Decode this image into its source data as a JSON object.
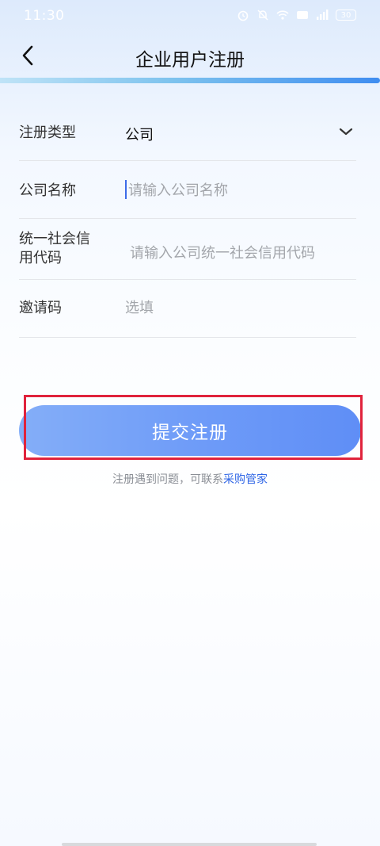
{
  "status_bar": {
    "time": "11:30",
    "battery": "30",
    "icons": [
      "alarm-icon",
      "mute-icon",
      "wifi-icon",
      "hd-icon",
      "signal-icon",
      "battery-icon"
    ]
  },
  "header": {
    "title": "企业用户注册",
    "back_icon": "chevron-left-icon"
  },
  "form": {
    "type_label": "注册类型",
    "type_value": "公司",
    "name_label": "公司名称",
    "name_placeholder": "请输入公司名称",
    "code_label": "统一社会信用代码",
    "code_placeholder": "请输入公司统一社会信用代码",
    "invite_label": "邀请码",
    "invite_placeholder": "选填"
  },
  "submit": {
    "label": "提交注册"
  },
  "help": {
    "text": "注册遇到问题，可联系",
    "link": "采购管家"
  },
  "colors": {
    "accent": "#5f8ef6",
    "link": "#2f66e6",
    "highlight_box": "#e0233c"
  }
}
